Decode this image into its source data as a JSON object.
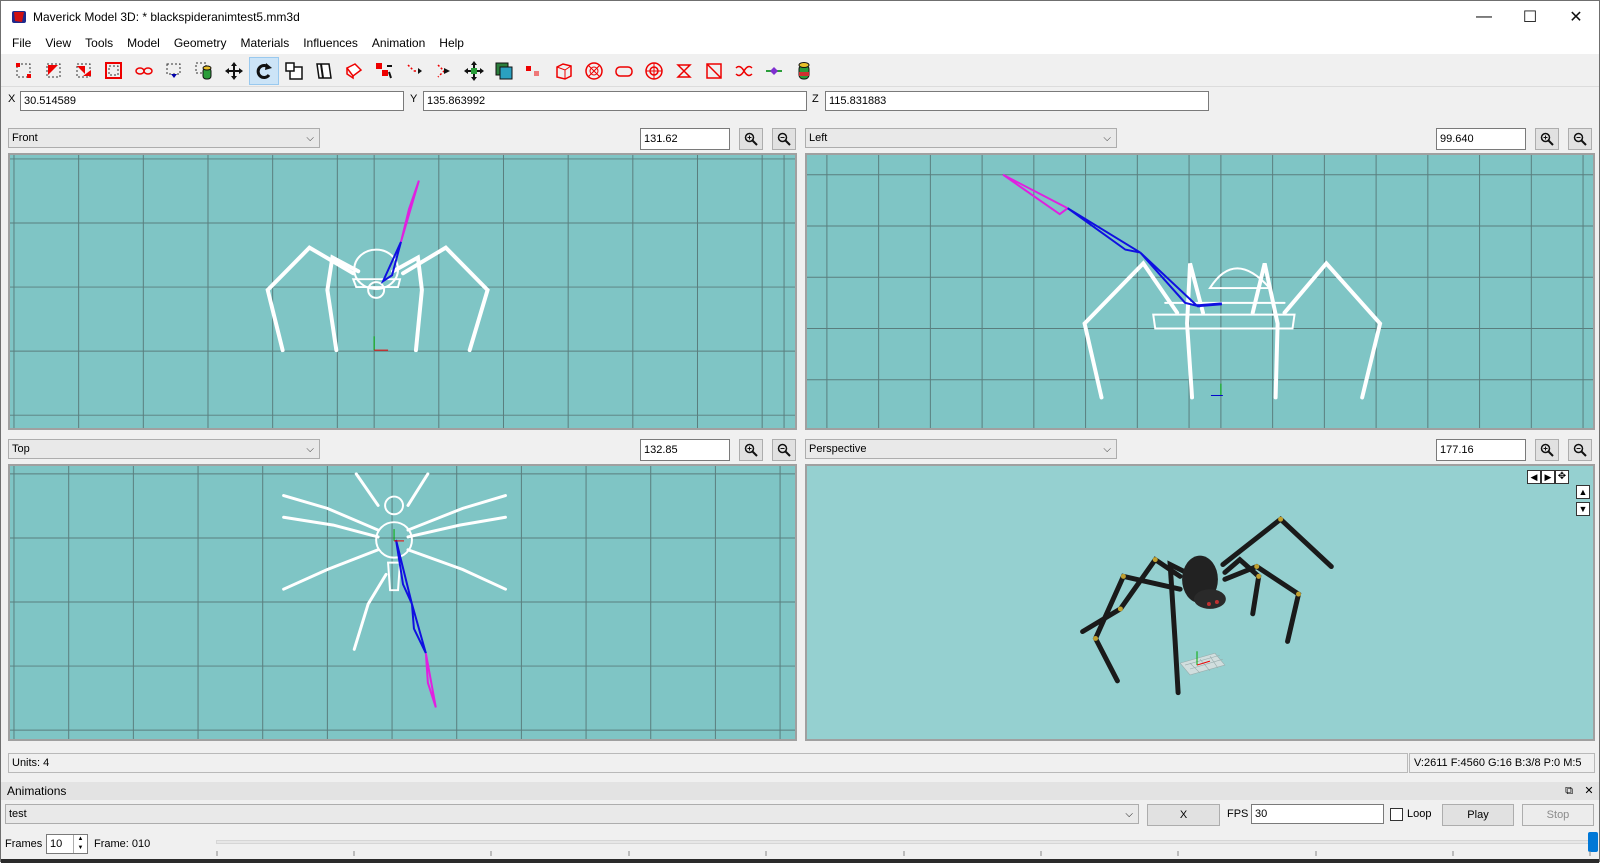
{
  "window": {
    "title": "Maverick Model 3D: * blackspideranimtest5.mm3d",
    "controls": [
      "—",
      "☐",
      "✕"
    ]
  },
  "menu": [
    "File",
    "View",
    "Tools",
    "Model",
    "Geometry",
    "Materials",
    "Influences",
    "Animation",
    "Help"
  ],
  "toolbar": {
    "tools": [
      "select-vertices-icon",
      "select-faces-icon",
      "select-connected-icon",
      "select-groups-icon",
      "select-bone-joints-icon",
      "select-points-icon",
      "select-projections-icon",
      "move-icon",
      "rotate-icon",
      "scale-icon",
      "shear-icon",
      "extrude-icon",
      "attract-near-icon",
      "attract-far-icon",
      "cube-icon",
      "bone-joint-icon",
      "point-icon",
      "projection-icon",
      "background-icon",
      "ellipsoid-icon",
      "polygon-icon",
      "torus-icon",
      "cylinder-icon",
      "torus-wire-icon",
      "drag-vertex-icon",
      "drag-vertex-2-icon",
      "vertex-icon",
      "cylinder-color-icon"
    ],
    "active_tool_index": 8
  },
  "coords": {
    "x_label": "X",
    "x_value": "30.514589",
    "y_label": "Y",
    "y_value": "135.863992",
    "z_label": "Z",
    "z_value": "115.831883"
  },
  "viewports": {
    "top_left": {
      "view": "Front",
      "zoom": "131.62"
    },
    "top_right": {
      "view": "Left",
      "zoom": "99.640"
    },
    "bottom_left": {
      "view": "Top",
      "zoom": "132.85"
    },
    "bottom_right": {
      "view": "Perspective",
      "zoom": "177.16"
    }
  },
  "status": {
    "units": "Units: 4",
    "counts": "V:2611 F:4560 G:16 B:3/8 P:0 M:5"
  },
  "animations": {
    "panel_title": "Animations",
    "dock_buttons": [
      "⧉",
      "✕"
    ],
    "selected": "test",
    "delete_label": "X",
    "fps_label": "FPS",
    "fps_value": "30",
    "loop_label": "Loop",
    "loop_checked": false,
    "play_label": "Play",
    "stop_label": "Stop",
    "frames_label": "Frames",
    "frames_value": "10",
    "frame_label": "Frame: 010"
  },
  "colors": {
    "viewport_bg": "#7fc5c5",
    "perspective_bg": "#95d0d0",
    "grid": "#5a7e7e",
    "wire": "#ffffff",
    "bone_blue": "#1010e0",
    "bone_magenta": "#e020e0"
  }
}
